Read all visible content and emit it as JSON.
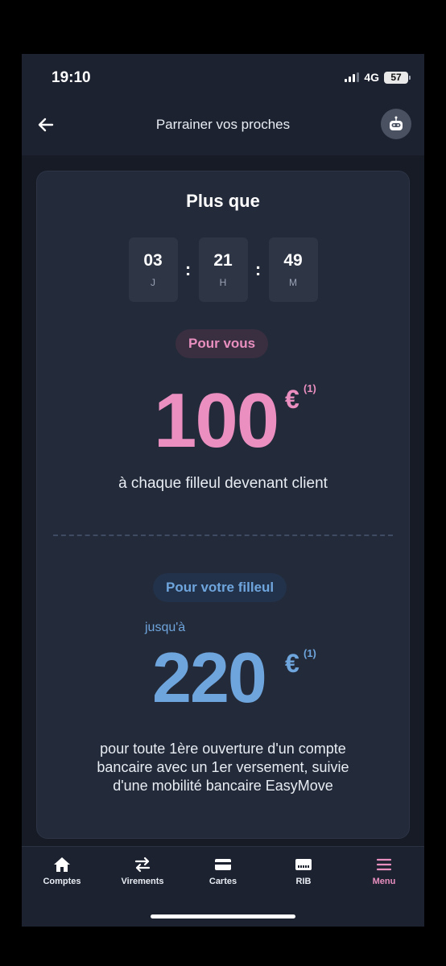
{
  "status": {
    "time": "19:10",
    "network": "4G",
    "battery": "57"
  },
  "header": {
    "title": "Parrainer vos proches"
  },
  "offer": {
    "title": "Plus que",
    "countdown": [
      {
        "value": "03",
        "unit": "J"
      },
      {
        "value": "21",
        "unit": "H"
      },
      {
        "value": "49",
        "unit": "M"
      }
    ],
    "you": {
      "label": "Pour vous",
      "amount": "100",
      "currency": "€",
      "footnote": "(1)",
      "description": "à chaque filleul devenant client"
    },
    "filleul": {
      "label": "Pour votre filleul",
      "prefix": "jusqu'à",
      "amount": "220",
      "currency": "€",
      "footnote": "(1)",
      "description_lines": [
        "pour toute 1ère ouverture d'un compte",
        "bancaire avec un 1er versement, suivie",
        "d'une mobilité bancaire EasyMove"
      ]
    }
  },
  "tabbar": {
    "items": [
      {
        "label": "Comptes",
        "icon": "home-icon"
      },
      {
        "label": "Virements",
        "icon": "transfer-icon"
      },
      {
        "label": "Cartes",
        "icon": "card-icon"
      },
      {
        "label": "RIB",
        "icon": "rib-icon"
      },
      {
        "label": "Menu",
        "icon": "menu-icon"
      }
    ],
    "active_index": 4
  },
  "colors": {
    "accent_pink": "#ea8fc0",
    "accent_blue": "#6fa5dd",
    "background": "#1c2230"
  }
}
